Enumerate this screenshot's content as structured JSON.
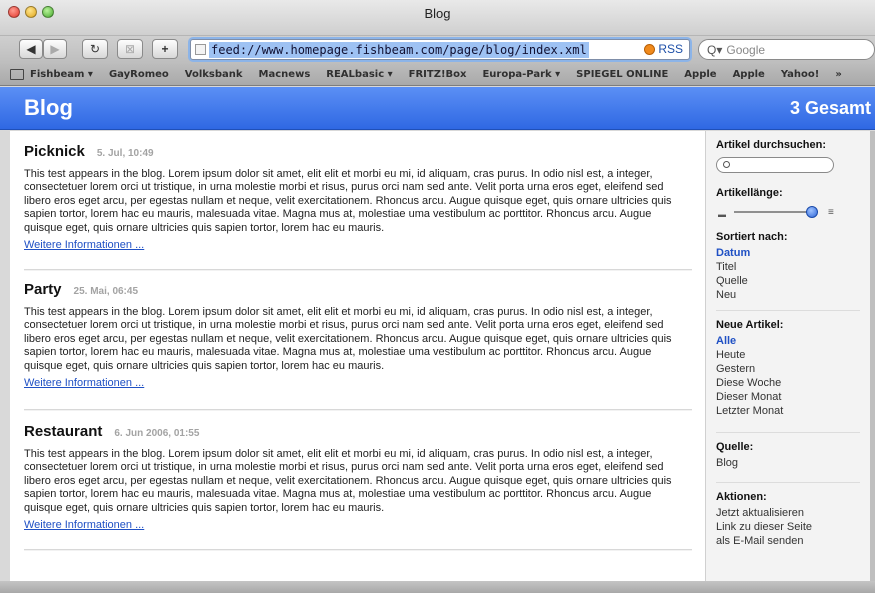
{
  "window": {
    "title": "Blog"
  },
  "toolbar": {
    "back": "◀",
    "forward": "▶",
    "reload": "↻",
    "add": "+",
    "url": "feed://www.homepage.fishbeam.com/page/blog/index.xml",
    "rss_label": "RSS",
    "search_placeholder": "Google"
  },
  "bookmarks": [
    "Fishbeam ▾",
    "GayRomeo",
    "Volksbank",
    "Macnews",
    "REALbasic ▾",
    "FRITZ!Box",
    "Europa-Park ▾",
    "SPIEGEL ONLINE",
    "Apple",
    "Apple",
    "Yahoo!",
    "»"
  ],
  "header": {
    "title": "Blog",
    "count": "3 Gesamt"
  },
  "articles": [
    {
      "title": "Picknick",
      "date": "5. Jul, 10:49",
      "body": "This test appears in the blog. Lorem ipsum dolor sit amet, elit elit et morbi eu mi, id aliquam, cras purus. In odio nisl est, a integer, consectetuer lorem orci ut tristique, in urna molestie morbi et risus, purus orci nam sed ante. Velit porta urna eros eget, eleifend sed libero eros eget arcu, per egestas nullam et neque, velit exercitationem. Rhoncus arcu. Augue quisque eget, quis ornare ultricies quis sapien tortor, lorem hac eu mauris, malesuada vitae. Magna mus at, molestiae uma vestibulum ac porttitor. Rhoncus arcu. Augue quisque eget, quis ornare ultricies quis sapien tortor, lorem hac eu mauris.",
      "more": "Weitere Informationen ..."
    },
    {
      "title": "Party",
      "date": "25. Mai, 06:45",
      "body": "This test appears in the blog. Lorem ipsum dolor sit amet, elit elit et morbi eu mi, id aliquam, cras purus. In odio nisl est, a integer, consectetuer lorem orci ut tristique, in urna molestie morbi et risus, purus orci nam sed ante. Velit porta urna eros eget, eleifend sed libero eros eget arcu, per egestas nullam et neque, velit exercitationem. Rhoncus arcu. Augue quisque eget, quis ornare ultricies quis sapien tortor, lorem hac eu mauris, malesuada vitae. Magna mus at, molestiae uma vestibulum ac porttitor. Rhoncus arcu. Augue quisque eget, quis ornare ultricies quis sapien tortor, lorem hac eu mauris.",
      "more": "Weitere Informationen ..."
    },
    {
      "title": "Restaurant",
      "date": "6. Jun 2006, 01:55",
      "body": "This test appears in the blog. Lorem ipsum dolor sit amet, elit elit et morbi eu mi, id aliquam, cras purus. In odio nisl est, a integer, consectetuer lorem orci ut tristique, in urna molestie morbi et risus, purus orci nam sed ante. Velit porta urna eros eget, eleifend sed libero eros eget arcu, per egestas nullam et neque, velit exercitationem. Rhoncus arcu. Augue quisque eget, quis ornare ultricies quis sapien tortor, lorem hac eu mauris, malesuada vitae. Magna mus at, molestiae uma vestibulum ac porttitor. Rhoncus arcu. Augue quisque eget, quis ornare ultricies quis sapien tortor, lorem hac eu mauris.",
      "more": "Weitere Informationen ..."
    }
  ],
  "sidebar": {
    "search_heading": "Artikel durchsuchen:",
    "length_heading": "Artikellänge:",
    "length_level": 0.95,
    "sort_heading": "Sortiert nach:",
    "sort_options": [
      "Datum",
      "Titel",
      "Quelle",
      "Neu"
    ],
    "new_heading": "Neue Artikel:",
    "new_options": [
      "Alle",
      "Heute",
      "Gestern",
      "Diese Woche",
      "Dieser Monat",
      "Letzter Monat"
    ],
    "source_heading": "Quelle:",
    "source_value": "Blog",
    "actions_heading": "Aktionen:",
    "actions": [
      "Jetzt aktualisieren",
      "Link zu dieser Seite",
      "als E-Mail senden"
    ]
  },
  "colors": {
    "header_blue": "#3a74ea",
    "link_blue": "#1f50c4",
    "rss_orange": "#f08a1c"
  }
}
